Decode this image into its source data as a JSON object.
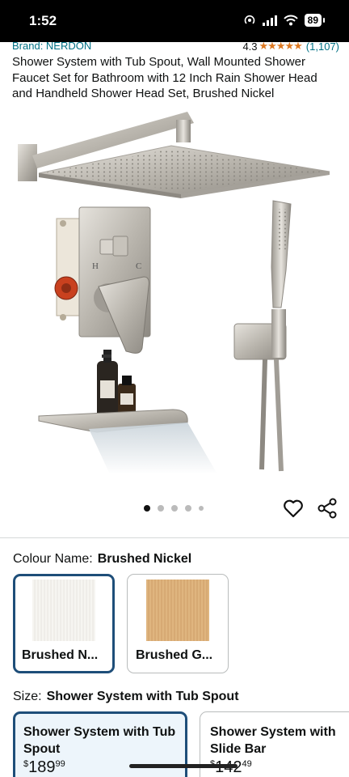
{
  "status_bar": {
    "time": "1:52",
    "battery": "89"
  },
  "product": {
    "brand": "Brand: NERDON",
    "rating": "4.3",
    "stars": "★★★★★",
    "rating_count": "(1,107)",
    "title": "Shower System with Tub Spout, Wall Mounted Shower Faucet Set for Bathroom with 12 Inch Rain Shower Head and Handheld Shower Head Set, Brushed Nickel",
    "image_letters": {
      "hot": "H",
      "cold": "C"
    }
  },
  "carousel": {
    "total_dots": 5,
    "active_index": 0
  },
  "colour": {
    "label": "Colour Name:",
    "selected": "Brushed Nickel",
    "options": [
      {
        "label": "Brushed N...",
        "color": "#efeeea"
      },
      {
        "label": "Brushed G...",
        "color": "#dbb07a"
      }
    ]
  },
  "size": {
    "label": "Size:",
    "selected": "Shower System with Tub Spout",
    "options": [
      {
        "title": "Shower System with Tub Spout",
        "currency": "$",
        "whole": "189",
        "fraction": "99"
      },
      {
        "title": "Shower System with Slide Bar",
        "currency": "$",
        "whole": "142",
        "fraction": "49"
      }
    ]
  }
}
